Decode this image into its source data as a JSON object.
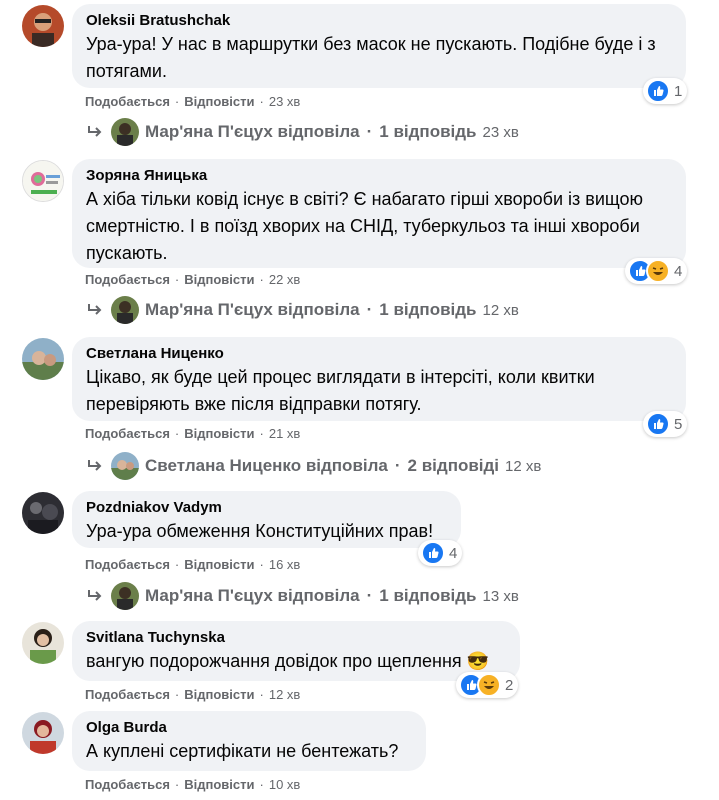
{
  "colors": {
    "bubble_bg": "#f0f2f5",
    "meta_text": "#65676b",
    "like_blue": "#1877f2",
    "haha_yellow": "#f7b125"
  },
  "comments": [
    {
      "author": "Oleksii Bratushchak",
      "text": "Ура-ура! У нас в маршрутки без масок не пускають. Подібне буде і з потягами.",
      "reactions": {
        "icons": [
          "like-icon"
        ],
        "count": "1"
      },
      "actions": {
        "like": "Подобається",
        "reply": "Відповісти",
        "time": "23 хв"
      },
      "replies": {
        "author": "Мар'яна П'єцух відповіла",
        "count": "1 відповідь",
        "time": "23 хв"
      }
    },
    {
      "author": "Зоряна Яницька",
      "text": "А хіба тільки ковід існує в світі? Є набагато гірші хвороби із вищою смертністю. І в поїзд хворих на СНІД, туберкульоз та інші хвороби пускають.",
      "reactions": {
        "icons": [
          "like-icon",
          "haha-icon"
        ],
        "count": "4"
      },
      "actions": {
        "like": "Подобається",
        "reply": "Відповісти",
        "time": "22 хв"
      },
      "replies": {
        "author": "Мар'яна П'єцух відповіла",
        "count": "1 відповідь",
        "time": "12 хв"
      }
    },
    {
      "author": "Светлана Ниценко",
      "text": "Цікаво, як буде цей процес виглядати в інтерсіті, коли квитки перевіряють вже після відправки потягу.",
      "reactions": {
        "icons": [
          "like-icon"
        ],
        "count": "5"
      },
      "actions": {
        "like": "Подобається",
        "reply": "Відповісти",
        "time": "21 хв"
      },
      "replies": {
        "author": "Светлана Ниценко відповіла",
        "count": "2 відповіді",
        "time": "12 хв"
      }
    },
    {
      "author": "Pozdniakov Vadym",
      "text": "Ура-ура обмеження Конституційних прав!",
      "reactions": {
        "icons": [
          "like-icon"
        ],
        "count": "4"
      },
      "actions": {
        "like": "Подобається",
        "reply": "Відповісти",
        "time": "16 хв"
      },
      "replies": {
        "author": "Мар'яна П'єцух відповіла",
        "count": "1 відповідь",
        "time": "13 хв"
      }
    },
    {
      "author": "Svitlana Tuchynska",
      "text": "вангую подорожчання довідок про щеплення 😎",
      "reactions": {
        "icons": [
          "like-icon",
          "haha-icon"
        ],
        "count": "2"
      },
      "actions": {
        "like": "Подобається",
        "reply": "Відповісти",
        "time": "12 хв"
      }
    },
    {
      "author": "Olga Burda",
      "text": "А куплені сертифікати не бентежать?",
      "actions": {
        "like": "Подобається",
        "reply": "Відповісти",
        "time": "10 хв"
      }
    }
  ]
}
